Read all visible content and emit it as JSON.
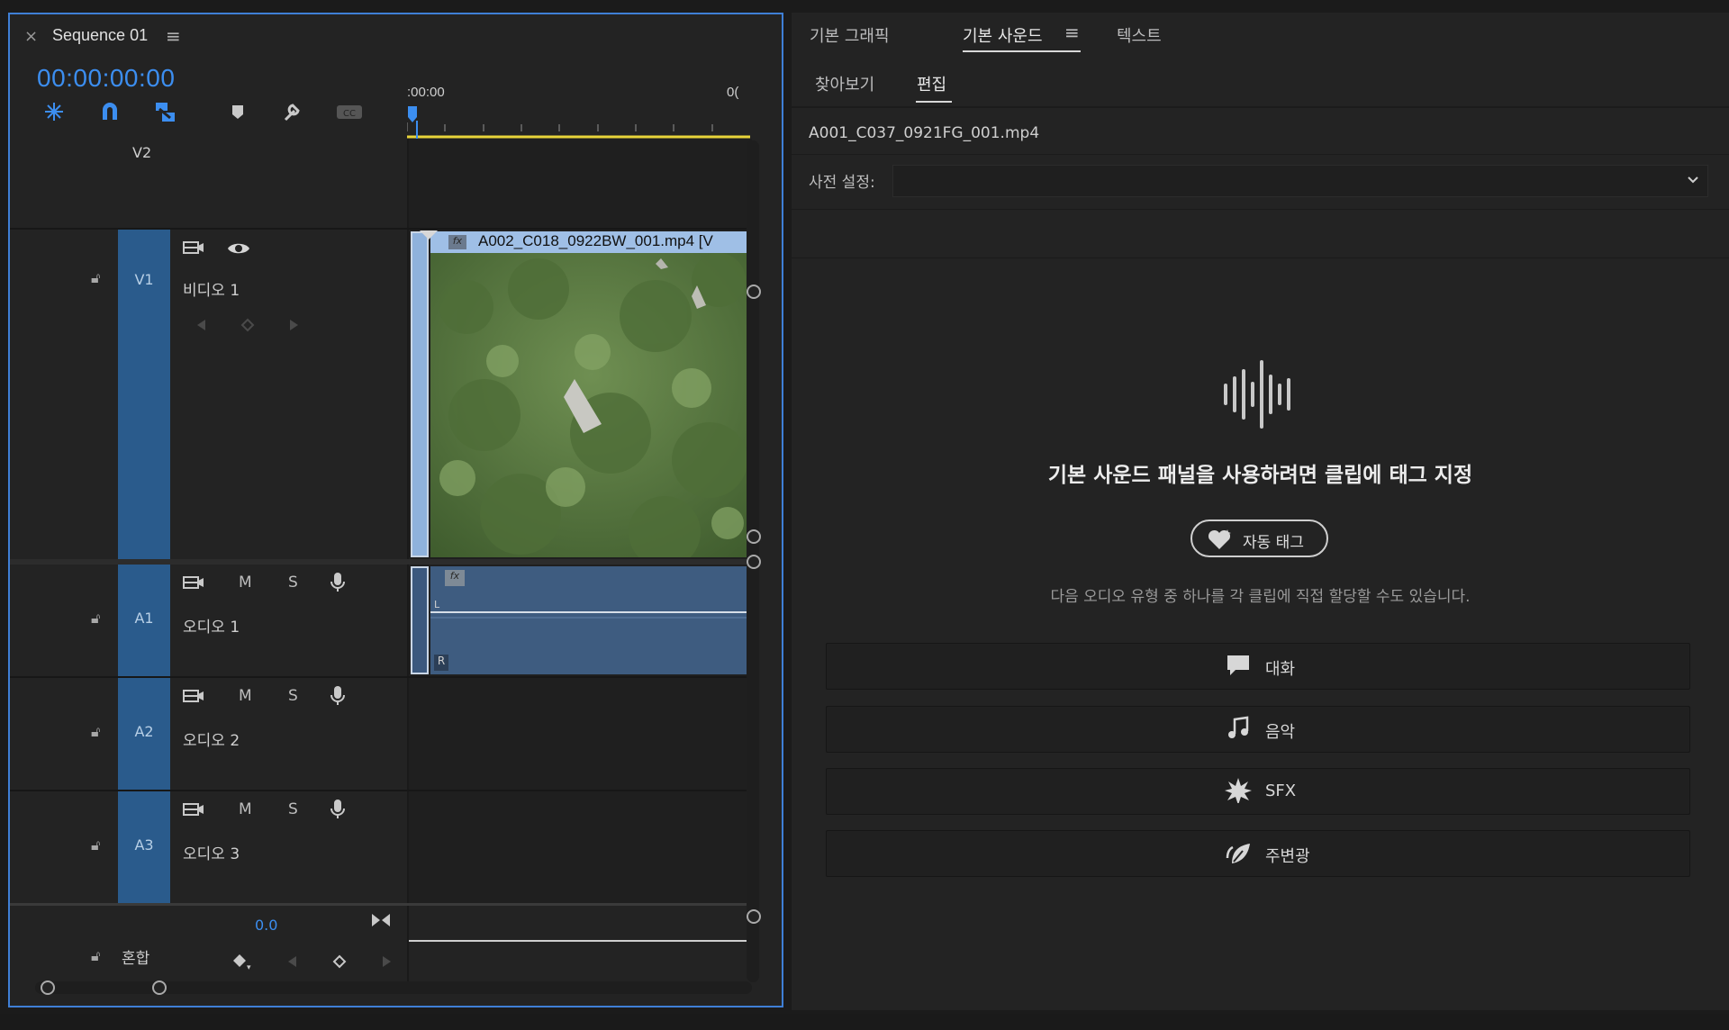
{
  "timeline": {
    "sequence_title": "Sequence 01",
    "close_glyph": "×",
    "menu_glyph": "≡",
    "timecode": "00:00:00:00",
    "ruler": {
      "start_label": ":00:00",
      "end_label": "0("
    },
    "tracks": [
      {
        "id": "V2",
        "name": ""
      },
      {
        "id": "V1",
        "name": "비디오 1"
      },
      {
        "id": "A1",
        "name": "오디오 1"
      },
      {
        "id": "A2",
        "name": "오디오 2"
      },
      {
        "id": "A3",
        "name": "오디오 3"
      }
    ],
    "mix": {
      "name": "혼합",
      "value": "0.0"
    },
    "video_clip": {
      "name": "A002_C018_0922BW_001.mp4 [V",
      "fx_badge": "fx"
    },
    "audio_clip": {
      "fx_badge": "fx",
      "left_channel": "L",
      "right_channel": "R"
    },
    "mute_label": "M",
    "solo_label": "S",
    "accent_color": "#3c8ef0",
    "track_color": "#2a5b8c"
  },
  "essential": {
    "top_tabs": [
      {
        "label": "기본 그래픽"
      },
      {
        "label": "기본 사운드"
      },
      {
        "label": "텍스트"
      }
    ],
    "sub_tabs": [
      {
        "label": "찾아보기"
      },
      {
        "label": "편집"
      }
    ],
    "menu_glyph": "≡",
    "filename": "A001_C037_0921FG_001.mp4",
    "preset_label": "사전 설정:",
    "preset_value": "",
    "headline": "기본 사운드 패널을 사용하려면 클립에 태그 지정",
    "auto_tag_label": "자동 태그",
    "hint": "다음 오디오 유형 중 하나를 각 클립에 직접 할당할 수도 있습니다.",
    "types": [
      {
        "label": "대화",
        "icon": "speech-bubble-icon"
      },
      {
        "label": "음악",
        "icon": "music-note-icon"
      },
      {
        "label": "SFX",
        "icon": "burst-icon"
      },
      {
        "label": "주변광",
        "icon": "leaf-icon"
      }
    ]
  }
}
